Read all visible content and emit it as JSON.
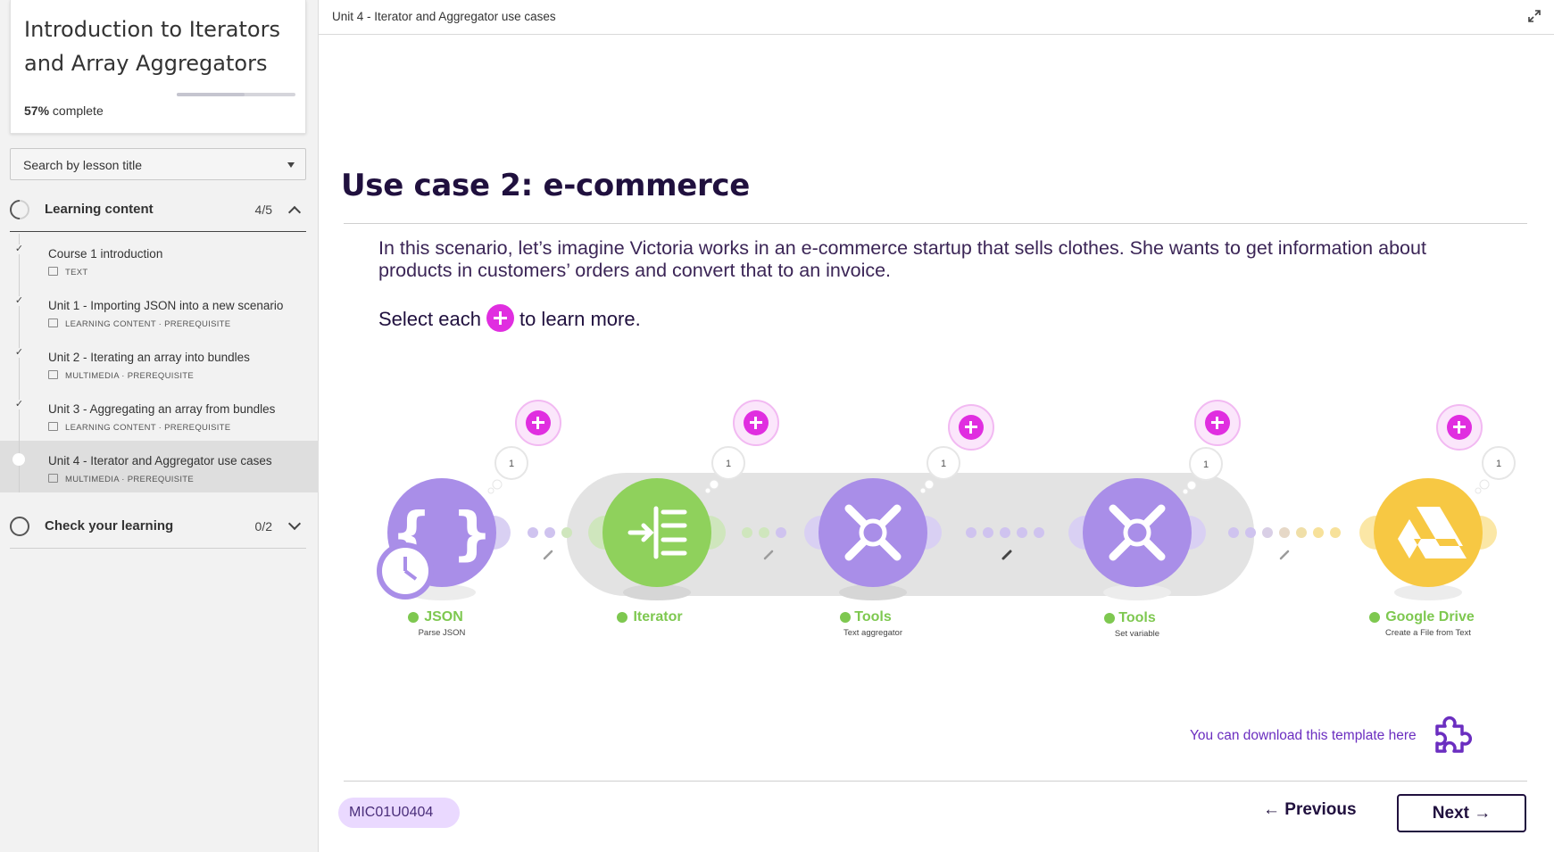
{
  "sidebar": {
    "course_title": "Introduction to Iterators and Array Aggregators",
    "progress_percent": 57,
    "progress_value": "57%",
    "progress_suffix": " complete",
    "search_placeholder": "Search by lesson title",
    "sections": [
      {
        "title": "Learning content",
        "count": "4/5",
        "expanded": true
      },
      {
        "title": "Check your learning",
        "count": "0/2",
        "expanded": false
      }
    ],
    "lessons": [
      {
        "title": "Course 1 introduction",
        "meta": "TEXT",
        "completed": true,
        "active": false
      },
      {
        "title": "Unit 1 - Importing JSON into a new scenario",
        "meta": "LEARNING CONTENT · PREREQUISITE",
        "completed": true,
        "active": false
      },
      {
        "title": "Unit 2 - Iterating an array into bundles",
        "meta": "MULTIMEDIA · PREREQUISITE",
        "completed": true,
        "active": false
      },
      {
        "title": "Unit 3 - Aggregating an array from bundles",
        "meta": "LEARNING CONTENT · PREREQUISITE",
        "completed": true,
        "active": false
      },
      {
        "title": "Unit 4 - Iterator and Aggregator use cases",
        "meta": "MULTIMEDIA · PREREQUISITE",
        "completed": false,
        "active": true
      }
    ]
  },
  "header": {
    "breadcrumb": "Unit 4 - Iterator and Aggregator use cases"
  },
  "content": {
    "heading": "Use case 2: e-commerce",
    "paragraph": "In this scenario, let’s imagine Victoria works in an e-commerce startup that sells clothes. She wants to get information about products in customers’ orders and convert that to an invoice.",
    "select_prefix": "Select each",
    "select_suffix": "to learn more.",
    "download_text": "You can download this template here"
  },
  "diagram": {
    "modules": [
      {
        "name": "JSON",
        "subtitle": "Parse JSON",
        "color": "#a98ee8",
        "icon": "braces-icon",
        "badge": "1"
      },
      {
        "name": "Iterator",
        "subtitle": "",
        "color": "#8fd15c",
        "icon": "iterator-icon",
        "badge": "1"
      },
      {
        "name": "Tools",
        "subtitle": "Text aggregator",
        "color": "#a98ee8",
        "icon": "tools-icon",
        "badge": "1"
      },
      {
        "name": "Tools",
        "subtitle": "Set variable",
        "color": "#a98ee8",
        "icon": "tools-icon",
        "badge": "1"
      },
      {
        "name": "Google Drive",
        "subtitle": "Create a File from Text",
        "color": "#f7c843",
        "icon": "google-drive-icon",
        "badge": "1"
      }
    ]
  },
  "footer": {
    "code": "MIC01U0404",
    "previous_label": "Previous",
    "next_label": "Next"
  },
  "colors": {
    "accent_magenta": "#e02ee0",
    "heading_navy": "#20103e",
    "link_purple": "#6b2ec0",
    "module_purple": "#a98ee8",
    "module_green": "#8fd15c",
    "module_yellow": "#f7c843",
    "status_green": "#7ec850"
  }
}
